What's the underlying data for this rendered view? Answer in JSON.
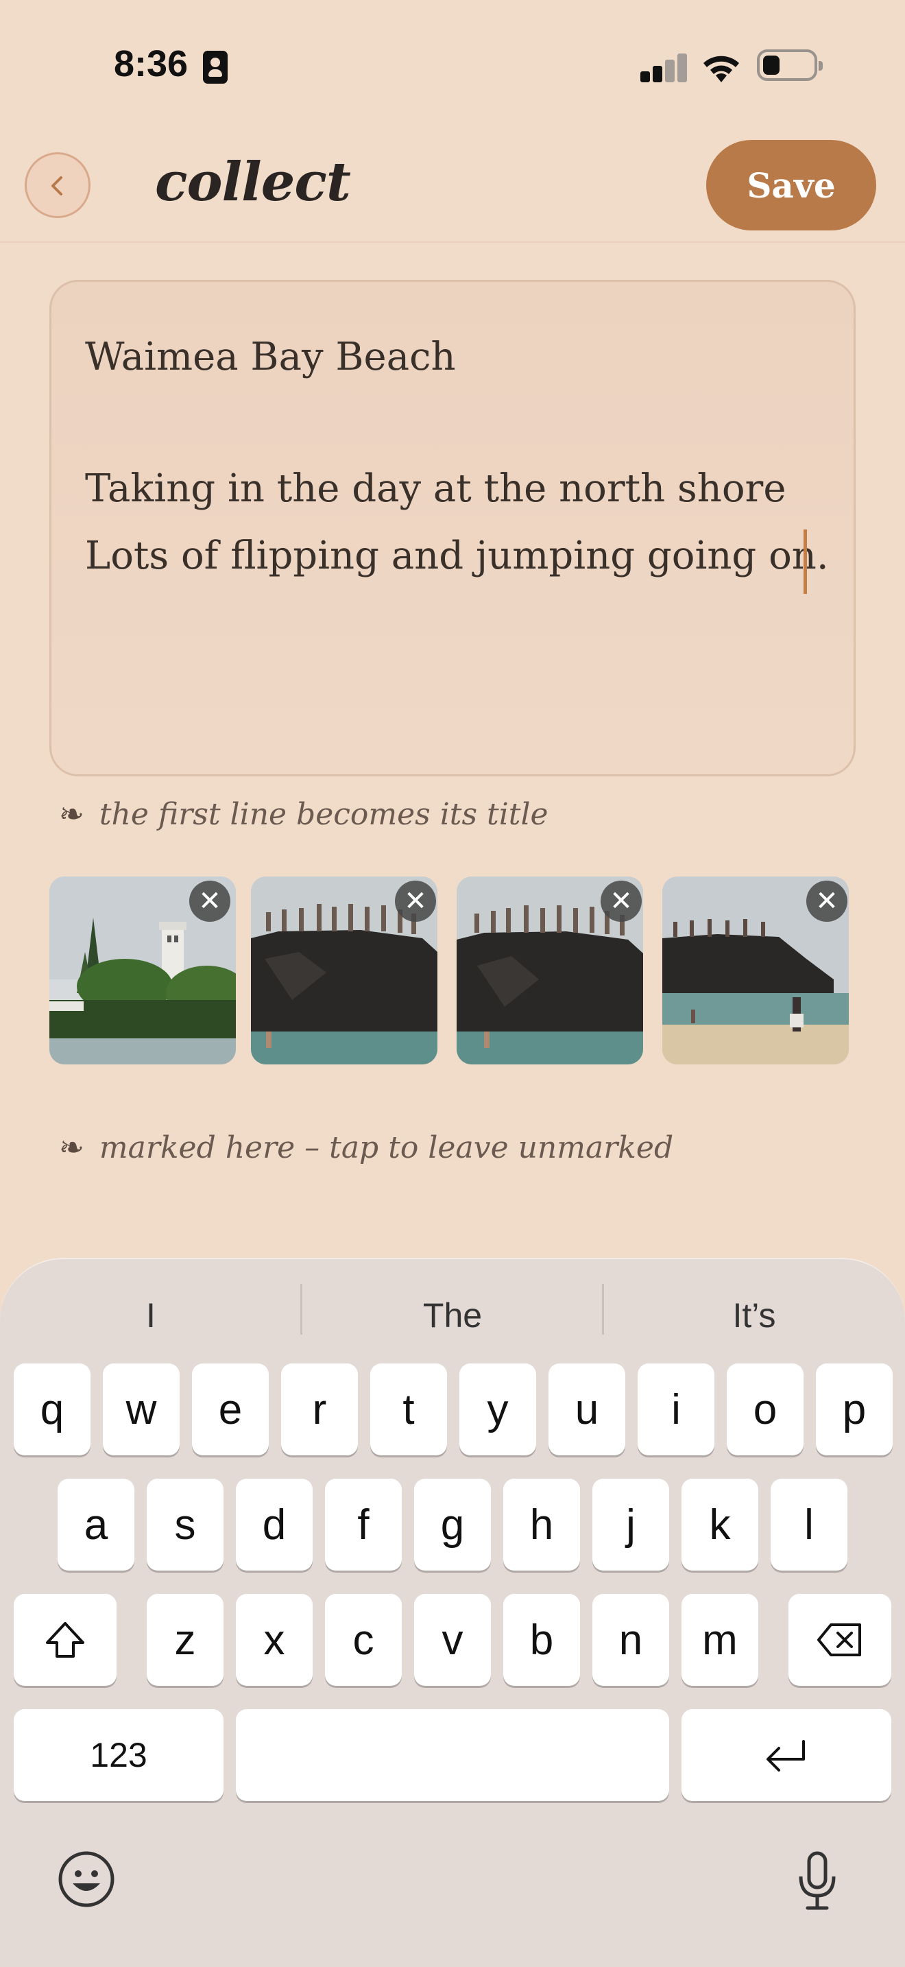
{
  "status_bar": {
    "time": "8:36",
    "icons": [
      "contact-card-icon",
      "cellular-signal-icon",
      "wifi-icon",
      "battery-icon"
    ]
  },
  "header": {
    "title": "collect",
    "save_label": "Save",
    "back_icon": "chevron-left-icon"
  },
  "note": {
    "lines": [
      "Waimea Bay Beach",
      "",
      "Taking in the day at the north shore",
      "Lots of flipping and jumping going on."
    ]
  },
  "hints": {
    "title_hint": "the first line becomes its title",
    "location_hint": "marked here – tap to leave unmarked",
    "icon": "fleuron-icon",
    "glyph": "❧"
  },
  "photos": [
    {
      "subject": "white bell tower among trees"
    },
    {
      "subject": "people standing on dark rock cliff over water"
    },
    {
      "subject": "people standing on dark rock cliff over water"
    },
    {
      "subject": "cliff with jumpers and beach with swimmers"
    }
  ],
  "remove_glyph": "✕",
  "keyboard": {
    "suggestions": [
      "I",
      "The",
      "It’s"
    ],
    "row1": [
      "q",
      "w",
      "e",
      "r",
      "t",
      "y",
      "u",
      "i",
      "o",
      "p"
    ],
    "row2": [
      "a",
      "s",
      "d",
      "f",
      "g",
      "h",
      "j",
      "k",
      "l"
    ],
    "row3": [
      "z",
      "x",
      "c",
      "v",
      "b",
      "n",
      "m"
    ],
    "numbers_label": "123",
    "icons": [
      "shift-icon",
      "delete-icon",
      "return-icon",
      "emoji-icon",
      "microphone-icon"
    ]
  },
  "colors": {
    "background": "#f1dcca",
    "accent": "#b97a4a",
    "cursor": "#c47d45"
  }
}
